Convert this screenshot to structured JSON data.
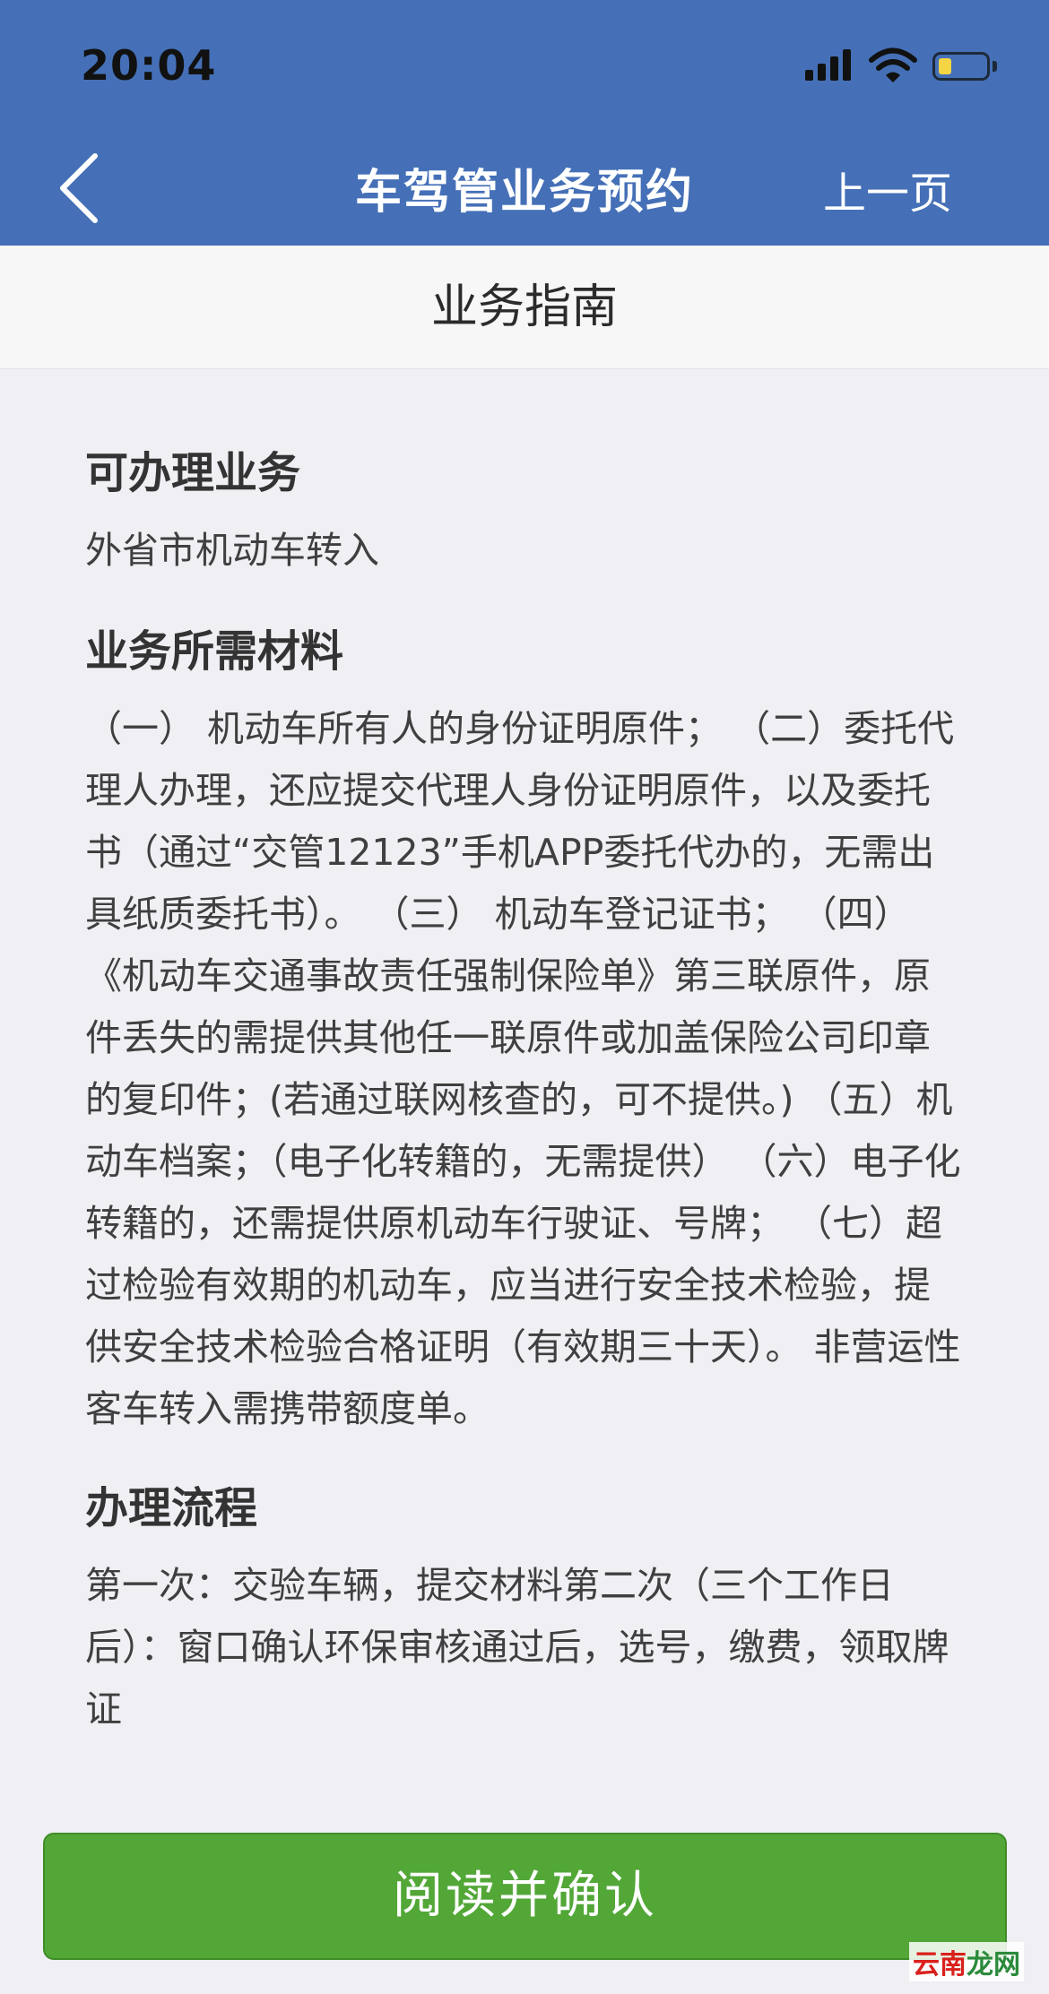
{
  "status_bar": {
    "time": "20:04"
  },
  "nav": {
    "title": "车驾管业务预约",
    "prev_label": "上一页",
    "back_icon": "chevron-left-icon",
    "background_color": "#4570b7"
  },
  "subheader": {
    "title": "业务指南"
  },
  "sections": [
    {
      "heading": "可办理业务",
      "text": "外省市机动车转入"
    },
    {
      "heading": "业务所需材料",
      "text": "（一） 机动车所有人的身份证明原件； （二）委托代理人办理，还应提交代理人身份证明原件，以及委托书（通过“交管12123”手机APP委托代办的，无需出具纸质委托书）。 （三） 机动车登记证书； （四）《机动车交通事故责任强制保险单》第三联原件，原件丢失的需提供其他任一联原件或加盖保险公司印章的复印件；(若通过联网核查的，可不提供。) （五）机动车档案；（电子化转籍的，无需提供） （六）电子化转籍的，还需提供原机动车行驶证、号牌； （七）超过检验有效期的机动车，应当进行安全技术检验，提供安全技术检验合格证明（有效期三十天）。 非营运性客车转入需携带额度单。"
    },
    {
      "heading": "办理流程",
      "text": "第一次：交验车辆，提交材料第二次（三个工作日后）：窗口确认环保审核通过后，选号，缴费，领取牌证"
    }
  ],
  "confirm_button": {
    "label": "阅读并确认",
    "color": "#52a737"
  },
  "watermark": {
    "part1": "云南",
    "part2": "龙网"
  }
}
